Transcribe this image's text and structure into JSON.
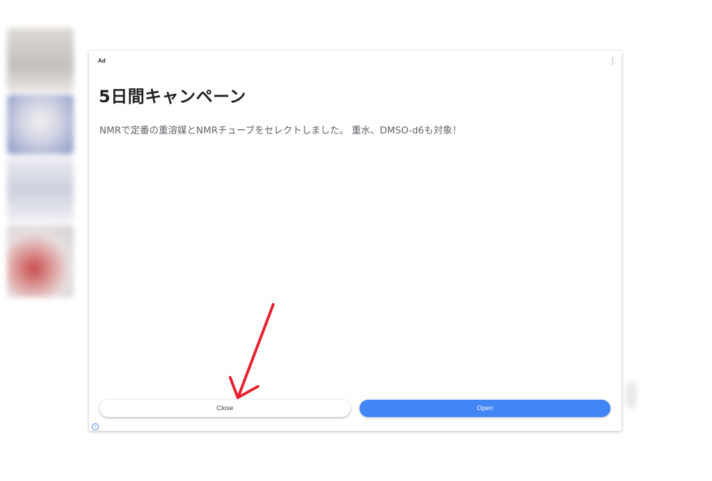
{
  "ad": {
    "label": "Ad",
    "headline": "5日間キャンペーン",
    "description": "NMRで定番の重溶媒とNMRチューブをセレクトしました。 重水、DMSO-d6も対象！",
    "close_label": "Close",
    "open_label": "Open",
    "info_glyph": "i"
  },
  "colors": {
    "accent_blue": "#4285f4",
    "annotation_red": "#e8202e"
  },
  "icons": {
    "menu": "kebab-menu-icon",
    "info": "info-icon",
    "annotation": "red-arrow-annotation"
  }
}
